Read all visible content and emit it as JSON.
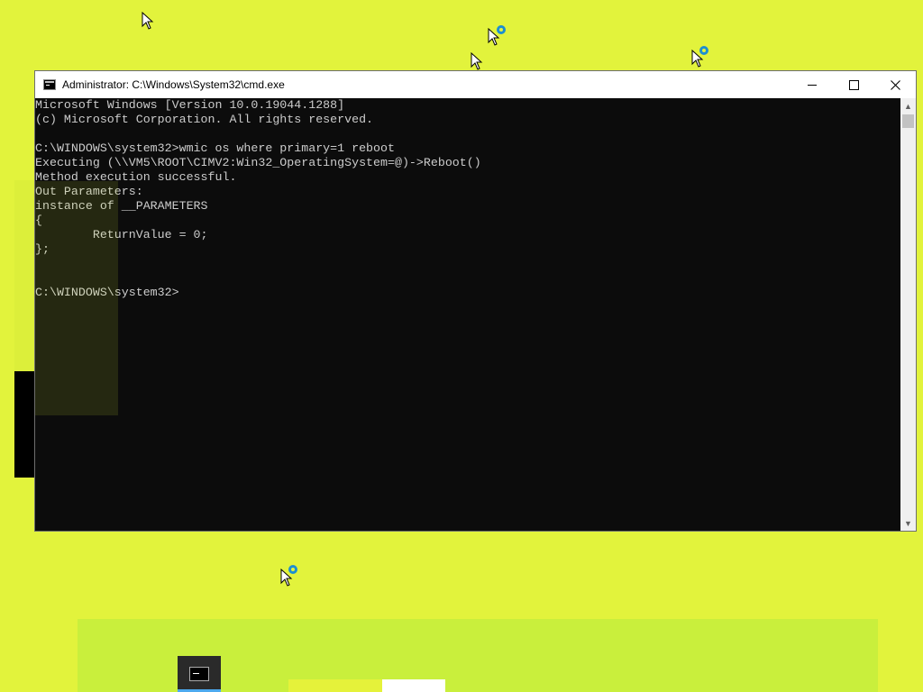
{
  "window": {
    "title": "Administrator: C:\\Windows\\System32\\cmd.exe",
    "minimize_label": "Minimize",
    "maximize_label": "Maximize",
    "close_label": "Close"
  },
  "console": {
    "lines": [
      "Microsoft Windows [Version 10.0.19044.1288]",
      "(c) Microsoft Corporation. All rights reserved.",
      "",
      "C:\\WINDOWS\\system32>wmic os where primary=1 reboot",
      "Executing (\\\\VM5\\ROOT\\CIMV2:Win32_OperatingSystem=@)->Reboot()",
      "Method execution successful.",
      "Out Parameters:",
      "instance of __PARAMETERS",
      "{",
      "        ReturnValue = 0;",
      "};",
      "",
      "",
      "C:\\WINDOWS\\system32>"
    ]
  },
  "taskbar": {
    "apps": [
      {
        "name": "cmd-icon",
        "active": true
      }
    ]
  },
  "colors": {
    "desktop": "#E2F33C",
    "console_bg": "#0C0C0C",
    "console_fg": "#CCCCCC",
    "titlebar": "#FFFFFF",
    "taskbar_active": "#4CA9EE"
  }
}
